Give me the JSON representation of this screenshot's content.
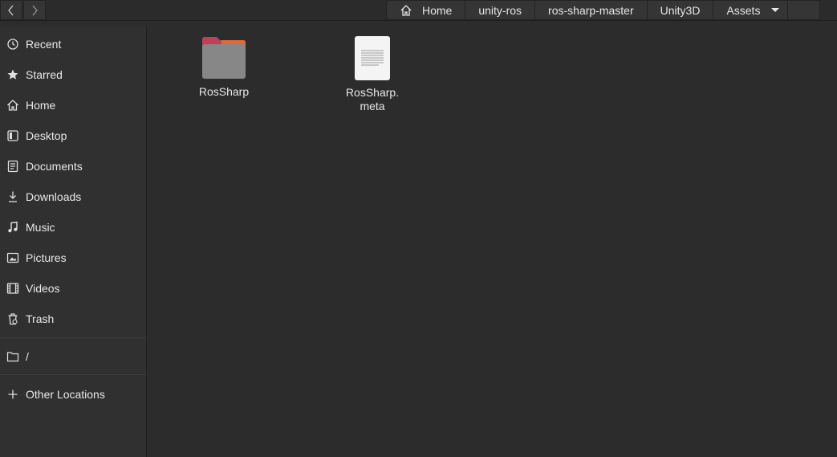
{
  "navigation": {
    "back_label": "‹",
    "forward_label": "›"
  },
  "pathbar": {
    "crumbs": [
      "Home",
      "unity-ros",
      "ros-sharp-master",
      "Unity3D",
      "Assets"
    ]
  },
  "sidebar": {
    "items": [
      {
        "label": "Recent",
        "icon": "clock-icon"
      },
      {
        "label": "Starred",
        "icon": "star-icon"
      },
      {
        "label": "Home",
        "icon": "home-icon"
      },
      {
        "label": "Desktop",
        "icon": "desktop-icon"
      },
      {
        "label": "Documents",
        "icon": "document-icon"
      },
      {
        "label": "Downloads",
        "icon": "download-icon"
      },
      {
        "label": "Music",
        "icon": "music-icon"
      },
      {
        "label": "Pictures",
        "icon": "picture-icon"
      },
      {
        "label": "Videos",
        "icon": "video-icon"
      },
      {
        "label": "Trash",
        "icon": "trash-icon"
      }
    ],
    "root_label": "/",
    "other_locations_label": "Other Locations"
  },
  "files": [
    {
      "name": "RosSharp",
      "type": "folder"
    },
    {
      "name": "RosSharp.",
      "name_line2": "meta",
      "type": "text-file"
    }
  ],
  "colors": {
    "background": "#2c2c2c",
    "sidebar": "#303030",
    "folder_body": "#8a8a8a",
    "folder_tab": "#c0405a"
  }
}
